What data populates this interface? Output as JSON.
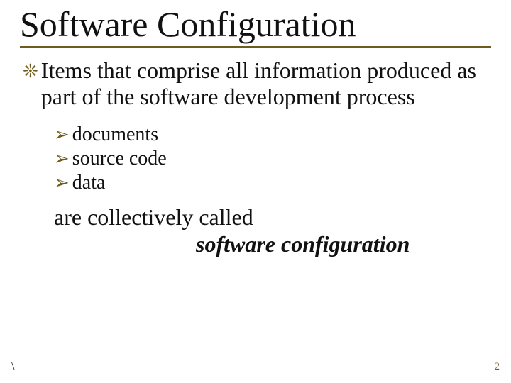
{
  "title": "Software Configuration",
  "main_bullet": "Items that comprise all information produced as part of the software development process",
  "sub_items": [
    "documents",
    "source code",
    "data"
  ],
  "closing_line": "are collectively called",
  "closing_emphasis": "software configuration",
  "footer_mark": "\\",
  "page_number": "2"
}
